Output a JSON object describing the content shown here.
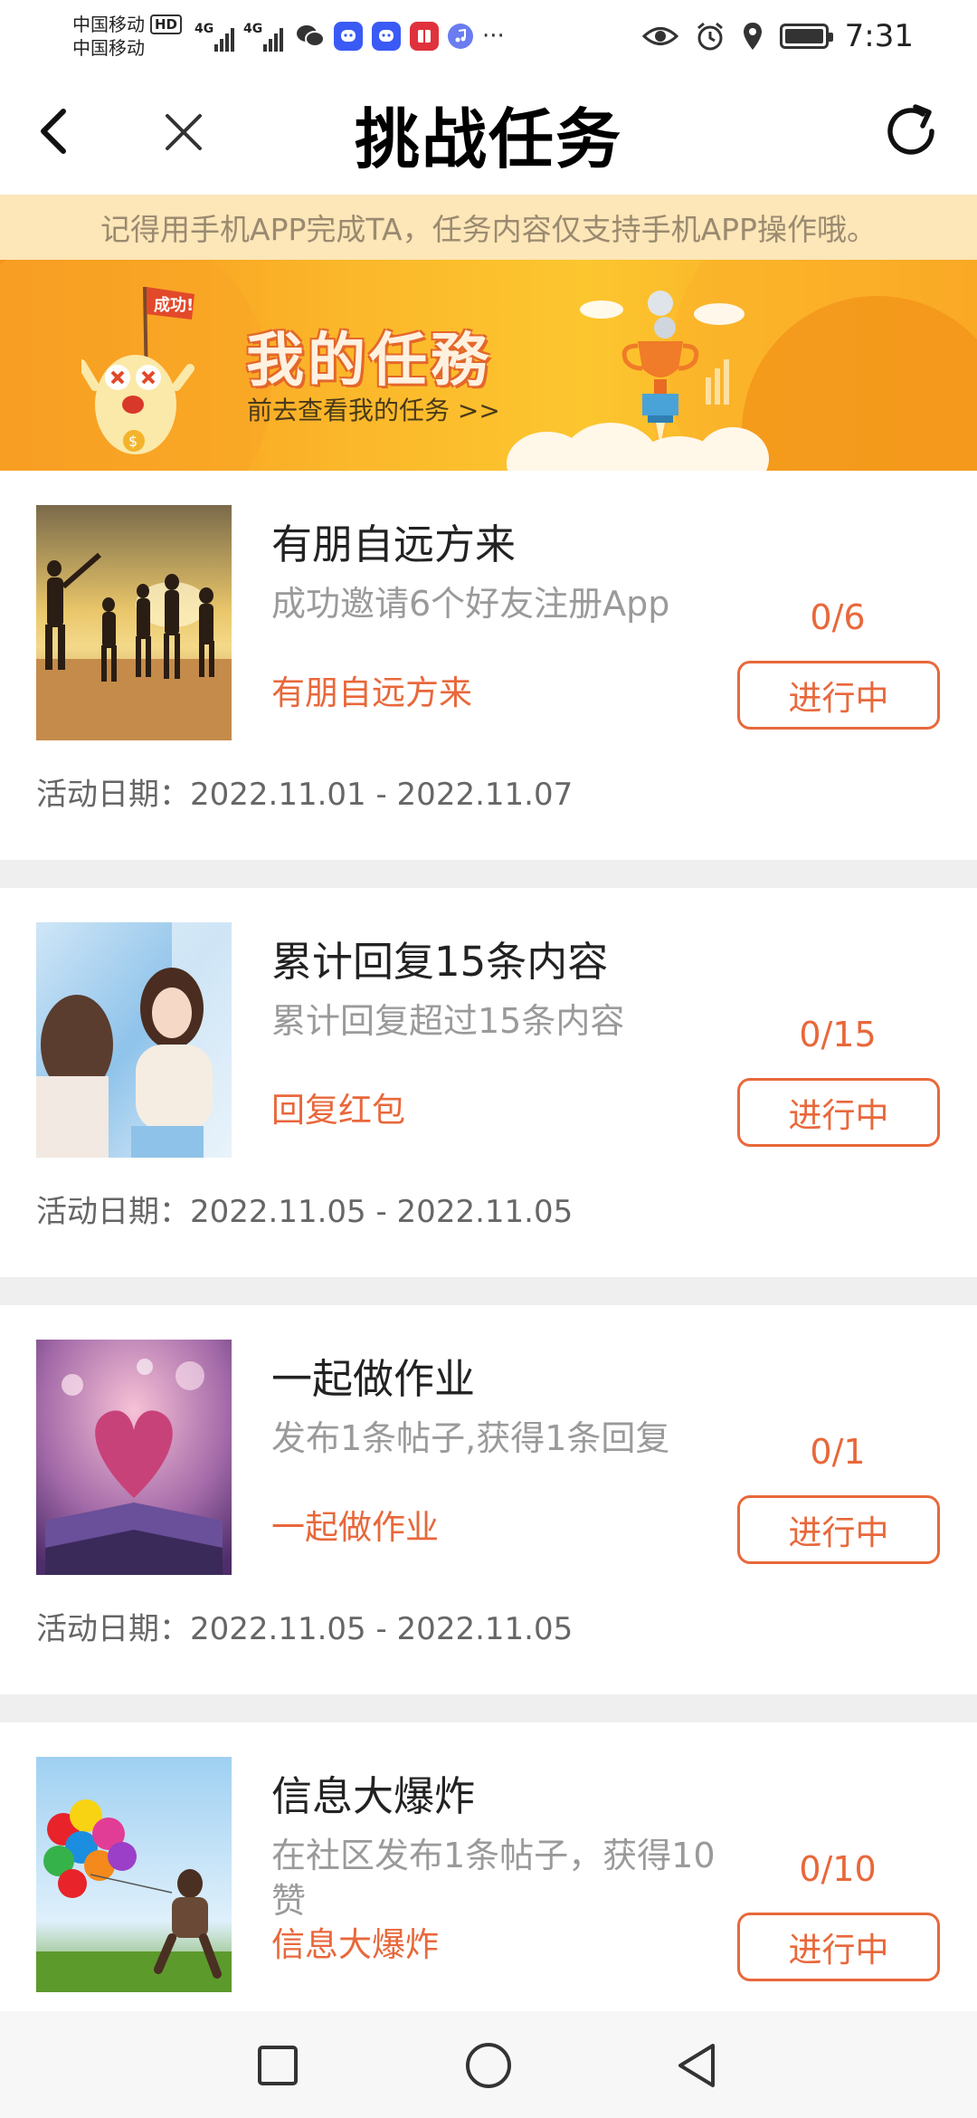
{
  "status_bar": {
    "carrier_1": "中国移动",
    "carrier_2": "中国移动",
    "hd": "HD",
    "net_1": "4G",
    "net_2": "4G",
    "more": "···",
    "time": "7:31"
  },
  "header": {
    "title": "挑战任务"
  },
  "notice": "记得用手机APP完成TA，任务内容仅支持手机APP操作哦。",
  "banner": {
    "flag": "成功!",
    "title": "我的任務",
    "subtitle": "前去查看我的任务 >>"
  },
  "tasks": [
    {
      "name": "有朋自远方来",
      "desc": "成功邀请6个好友注册App",
      "link": "有朋自远方来",
      "progress": "0/6",
      "status": "进行中",
      "dates": "活动日期：2022.11.01 - 2022.11.07"
    },
    {
      "name": "累计回复15条内容",
      "desc": "累计回复超过15条内容",
      "link": "回复红包",
      "progress": "0/15",
      "status": "进行中",
      "dates": "活动日期：2022.11.05 - 2022.11.05"
    },
    {
      "name": "一起做作业",
      "desc": "发布1条帖子,获得1条回复",
      "link": "一起做作业",
      "progress": "0/1",
      "status": "进行中",
      "dates": "活动日期：2022.11.05 - 2022.11.05"
    },
    {
      "name": "信息大爆炸",
      "desc": "在社区发布1条帖子，获得10赞",
      "link": "信息大爆炸",
      "progress": "0/10",
      "status": "进行中",
      "dates": ""
    }
  ],
  "colors": {
    "accent": "#e8683b",
    "notice_bg": "#fde6b8",
    "banner_orange": "#f7941d"
  },
  "icons": {
    "back": "chevron-left-icon",
    "close": "close-icon",
    "refresh": "refresh-icon",
    "nav_recent": "square-icon",
    "nav_home": "circle-icon",
    "nav_back": "triangle-back-icon"
  }
}
